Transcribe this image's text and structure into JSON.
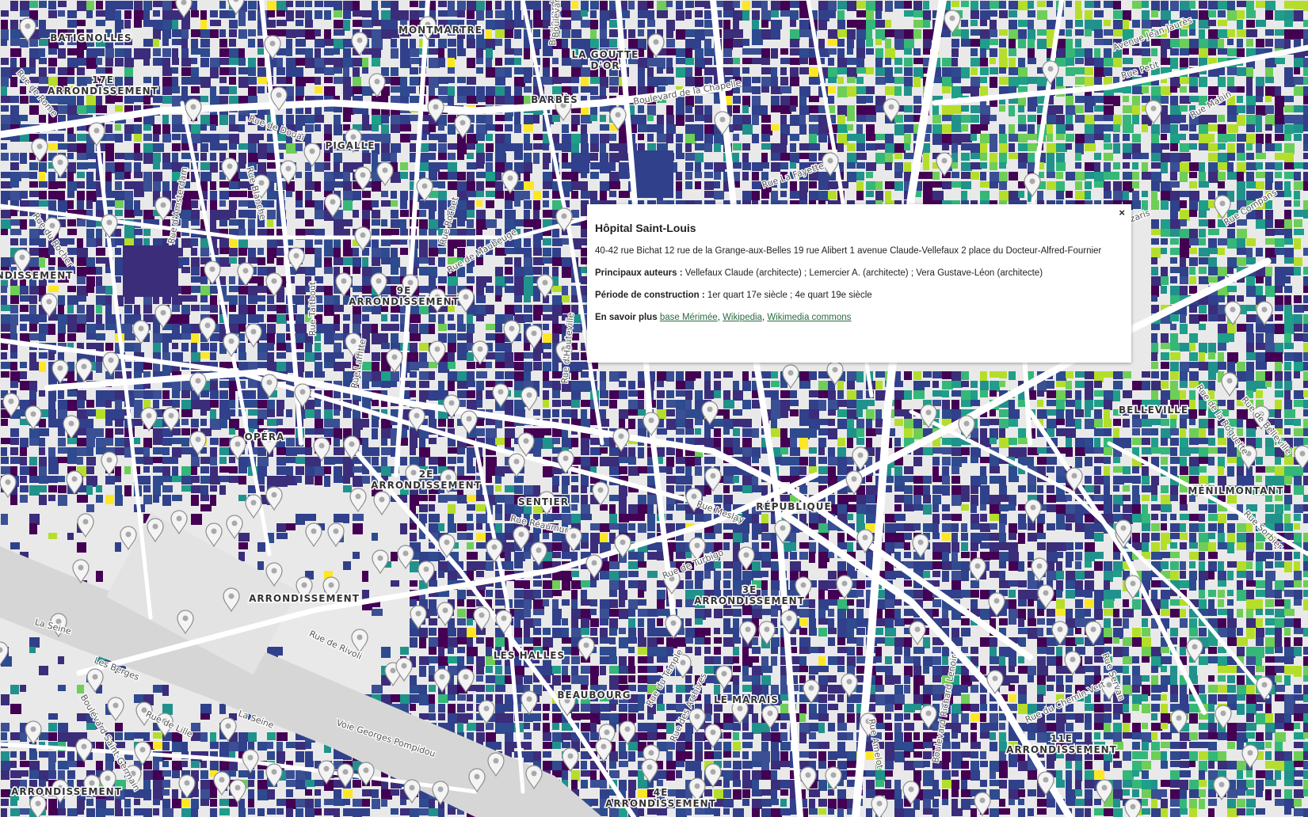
{
  "map": {
    "district_labels": [
      {
        "id": "batignolles",
        "lines": [
          "BATIGNOLLES"
        ]
      },
      {
        "id": "17e",
        "lines": [
          "17E",
          "ARRONDISSEMENT"
        ]
      },
      {
        "id": "montmartre",
        "lines": [
          "MONTMARTRE"
        ]
      },
      {
        "id": "goutte-dor",
        "lines": [
          "LA GOUTTE",
          "D'OR"
        ]
      },
      {
        "id": "barbes",
        "lines": [
          "BARBÈS"
        ]
      },
      {
        "id": "pigalle",
        "lines": [
          "PIGALLE"
        ]
      },
      {
        "id": "8e-left",
        "lines": [
          "ONDISSEMENT"
        ]
      },
      {
        "id": "9e",
        "lines": [
          "9E",
          "ARRONDISSEMENT"
        ]
      },
      {
        "id": "opera",
        "lines": [
          "OPÉRA"
        ]
      },
      {
        "id": "2e",
        "lines": [
          "2E",
          "ARRONDISSEMENT"
        ]
      },
      {
        "id": "sentier",
        "lines": [
          "SENTIER"
        ]
      },
      {
        "id": "republique",
        "lines": [
          "RÉPUBLIQUE"
        ]
      },
      {
        "id": "belleville",
        "lines": [
          "BELLEVILLE"
        ]
      },
      {
        "id": "menilmontant",
        "lines": [
          "MÉNILMONTANT"
        ]
      },
      {
        "id": "1er",
        "lines": [
          "ARRONDISSEMENT"
        ]
      },
      {
        "id": "3e",
        "lines": [
          "3E",
          "ARRONDISSEMENT"
        ]
      },
      {
        "id": "les-halles",
        "lines": [
          "LES HALLES"
        ]
      },
      {
        "id": "beaubourg",
        "lines": [
          "BEAUBOURG"
        ]
      },
      {
        "id": "le-marais",
        "lines": [
          "LE MARAIS"
        ]
      },
      {
        "id": "11e",
        "lines": [
          "11E",
          "ARRONDISSEMENT"
        ]
      },
      {
        "id": "6e",
        "lines": [
          "ARRONDISSEMENT"
        ]
      },
      {
        "id": "4e",
        "lines": [
          "4E",
          "ARRONDISSEMENT"
        ]
      }
    ],
    "street_labels": [
      {
        "id": "boulevard-chapelle",
        "text": "Boulevard de la Chapelle"
      },
      {
        "id": "avenue-jean-jaures",
        "text": "Avenue Jean Jaurès"
      },
      {
        "id": "rue-petit",
        "text": "Rue Petit"
      },
      {
        "id": "rue-manin",
        "text": "Rue Manin"
      },
      {
        "id": "rue-de-rome",
        "text": "Rue de Rome"
      },
      {
        "id": "rue-de-douai",
        "text": "Rue de Douai"
      },
      {
        "id": "rue-amsterdam",
        "text": "Rue d'Amsterdam"
      },
      {
        "id": "rue-blanche",
        "text": "Rue Blanche"
      },
      {
        "id": "rue-rochet",
        "text": "Rue Rochet"
      },
      {
        "id": "rue-maubeuge",
        "text": "Rue de Maubeuge"
      },
      {
        "id": "rue-la-fayette",
        "text": "Rue La Fayette"
      },
      {
        "id": "rue-compans",
        "text": "Rue Compans"
      },
      {
        "id": "rue-botzaris",
        "text": "otzaris"
      },
      {
        "id": "rue-taitbout",
        "text": "Rue Taitbout"
      },
      {
        "id": "rue-laffitte",
        "text": "Rue Laffitte"
      },
      {
        "id": "rue-hauteville",
        "text": "Rue d'Hauteville"
      },
      {
        "id": "rue-reaumur",
        "text": "Rue Réaumur"
      },
      {
        "id": "rue-meslay",
        "text": "Rue Meslay"
      },
      {
        "id": "rue-turbigo",
        "text": "Rue de Turbigo"
      },
      {
        "id": "rue-sorbier",
        "text": "Rue Sorbier"
      },
      {
        "id": "rue-belleville",
        "text": "Rue de Belleville"
      },
      {
        "id": "la-seine-1",
        "text": "La Seine"
      },
      {
        "id": "la-seine-2",
        "text": "La Seine"
      },
      {
        "id": "les-berges",
        "text": "Les Berges"
      },
      {
        "id": "voie-pompidou",
        "text": "Voie Georges Pompidou"
      },
      {
        "id": "rue-de-rivoli",
        "text": "Rue de Rivoli"
      },
      {
        "id": "rue-du-temple",
        "text": "Rue du Temple"
      },
      {
        "id": "rue-des-archives",
        "text": "Rue des Archives"
      },
      {
        "id": "bd-richard-lenoir",
        "text": "Boulevard Richard Lenoir"
      },
      {
        "id": "rue-chemin-vert",
        "text": "Rue du Chemin Vert"
      },
      {
        "id": "rue-servan",
        "text": "Rue Servan"
      },
      {
        "id": "bd-magenta",
        "text": "Boulevard"
      },
      {
        "id": "rue-roquette",
        "text": "Rue de la Roquette"
      },
      {
        "id": "rue-amelot",
        "text": "Rue Amelot"
      },
      {
        "id": "bd-saint-germain",
        "text": "Boulevard Saint-Germain"
      },
      {
        "id": "rue-lille",
        "text": "Rue de Lille"
      },
      {
        "id": "rue-rocher",
        "text": "Rue du Rocher"
      },
      {
        "id": "bd-barbes",
        "text": "Boulevard"
      }
    ]
  },
  "popup": {
    "close_label": "×",
    "title": "Hôpital Saint-Louis",
    "address": "40-42 rue Bichat 12 rue de la Grange-aux-Belles 19 rue Alibert 1 avenue Claude-Vellefaux 2 place du Docteur-Alfred-Fournier",
    "authors_label": "Principaux auteurs :",
    "authors_value": "Vellefaux Claude (architecte) ; Lemercier A. (architecte) ; Vera Gustave-Léon (architecte)",
    "period_label": "Période de construction :",
    "period_value": "1er quart 17e siècle ; 4e quart 19e siècle",
    "more_label": "En savoir plus",
    "links": [
      "base Mérimée",
      "Wikipedia",
      "Wikimedia commons"
    ],
    "link_sep": ", "
  },
  "colors": {
    "background": "#e9e9e9",
    "building_palette": [
      "#440154",
      "#3b2d7a",
      "#31408b",
      "#2d4b8e",
      "#3a4f94",
      "#21918c",
      "#1f9e89",
      "#35b779",
      "#6ece58",
      "#b5de2b",
      "#fde725"
    ],
    "roads": "#ffffff",
    "seine": "#d6d6d6",
    "marker": "#a9a9a9"
  }
}
